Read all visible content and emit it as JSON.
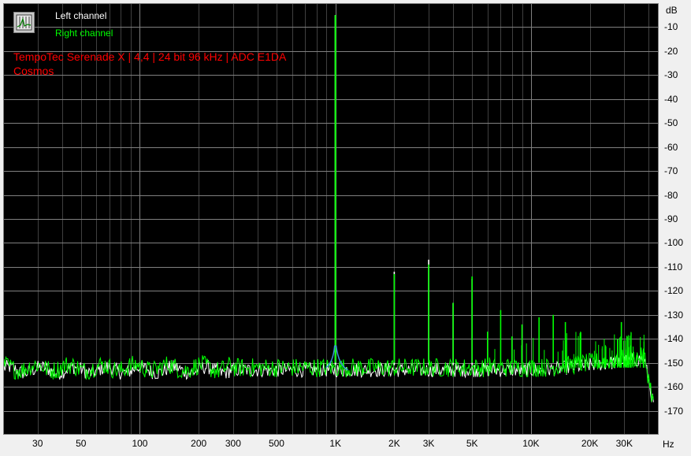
{
  "chart_data": {
    "type": "line",
    "title_lines": [
      "TempoTec Serenade X | 4,4 | 24 bit 96 kHz | ADC E1DA",
      "Cosmos"
    ],
    "ylabel": "dB",
    "xlabel": "Hz",
    "x_scale": "log",
    "xlim": [
      20,
      45000
    ],
    "ylim": [
      -180,
      0
    ],
    "y_ticks": [
      -10,
      -20,
      -30,
      -40,
      -50,
      -60,
      -70,
      -80,
      -90,
      -100,
      -110,
      -120,
      -130,
      -140,
      -150,
      -160,
      -170
    ],
    "y_tick_labels": [
      "-10",
      "-20",
      "-30",
      "-40",
      "-50",
      "-60",
      "-70",
      "-80",
      "-90",
      "-100",
      "-110",
      "-120",
      "-130",
      "-140",
      "-150",
      "-160",
      "-170"
    ],
    "x_ticks": [
      30,
      50,
      100,
      200,
      300,
      500,
      1000,
      2000,
      3000,
      5000,
      10000,
      20000,
      30000
    ],
    "x_tick_labels": [
      "30",
      "50",
      "100",
      "200",
      "300",
      "500",
      "1K",
      "2K",
      "3K",
      "5K",
      "10K",
      "20K",
      "30K"
    ],
    "grid": true,
    "legend_position": "top-left",
    "series": [
      {
        "name": "Left channel",
        "color": "#ffffff",
        "noise_floor_db": -153,
        "peaks": [
          {
            "x": 1000,
            "y": -5
          },
          {
            "x": 2000,
            "y": -112
          },
          {
            "x": 3000,
            "y": -107
          },
          {
            "x": 4000,
            "y": -125
          },
          {
            "x": 5000,
            "y": -115
          }
        ]
      },
      {
        "name": "Right channel",
        "color": "#00ff00",
        "noise_floor_db": -152,
        "peaks": [
          {
            "x": 1000,
            "y": -5
          },
          {
            "x": 2000,
            "y": -113
          },
          {
            "x": 3000,
            "y": -109
          },
          {
            "x": 4000,
            "y": -125
          },
          {
            "x": 5000,
            "y": -114
          },
          {
            "x": 6000,
            "y": -137
          },
          {
            "x": 7000,
            "y": -128
          },
          {
            "x": 8000,
            "y": -139
          },
          {
            "x": 9000,
            "y": -134
          },
          {
            "x": 11000,
            "y": -131
          },
          {
            "x": 13000,
            "y": -130
          },
          {
            "x": 15000,
            "y": -133
          },
          {
            "x": 29000,
            "y": -133
          }
        ]
      }
    ]
  },
  "colors": {
    "plot_background": "#000000",
    "grid_major": "#808080",
    "grid_minor": "#404040",
    "title": "#ff0000",
    "left_channel": "#ffffff",
    "right_channel": "#00ff00",
    "artifact_blue": "#3a8fd8"
  },
  "legend_icon": "spectrum-icon"
}
